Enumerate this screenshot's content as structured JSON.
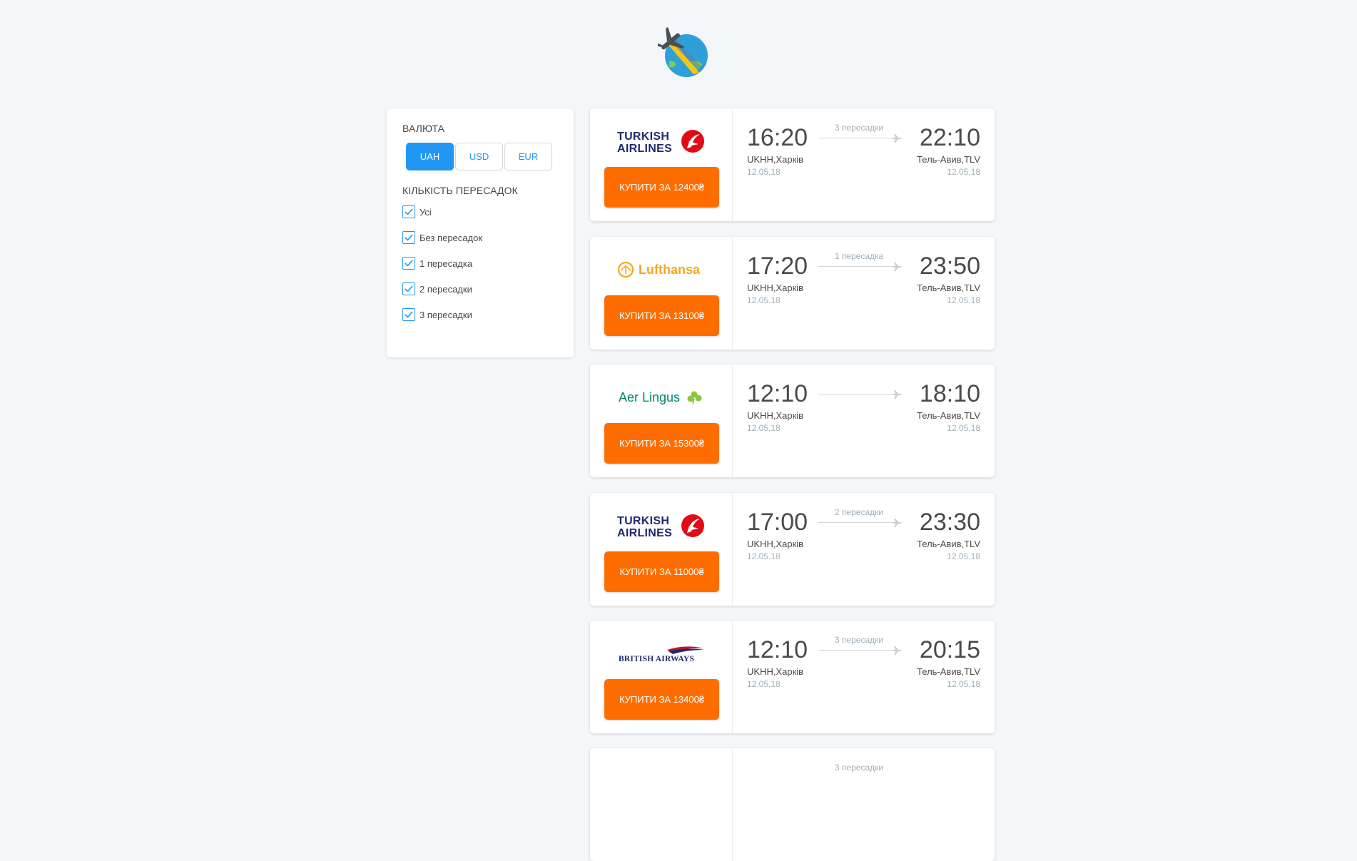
{
  "currency": {
    "title": "Валюта",
    "options": [
      "UAH",
      "USD",
      "EUR"
    ],
    "selected": "UAH"
  },
  "stops_filter": {
    "title": "Кількість пересадок",
    "options": [
      {
        "label": "Усі",
        "checked": true
      },
      {
        "label": "Без пересадок",
        "checked": true
      },
      {
        "label": "1 пересадка",
        "checked": true
      },
      {
        "label": "2 пересадки",
        "checked": true
      },
      {
        "label": "3 пересадки",
        "checked": true
      }
    ]
  },
  "tickets": [
    {
      "airline": "Turkish Airlines",
      "buy_label": "Купити за 12400₴",
      "departure_time": "16:20",
      "arrival_time": "22:10",
      "origin": "UKHH,Харків",
      "destination": "Тель-Авив,TLV",
      "departure_date": "12.05.18",
      "arrival_date": "12.05.18",
      "stops": "3 пересадки"
    },
    {
      "airline": "Lufthansa",
      "buy_label": "Купити за 13100₴",
      "departure_time": "17:20",
      "arrival_time": "23:50",
      "origin": "UKHH,Харків",
      "destination": "Тель-Авив,TLV",
      "departure_date": "12.05.18",
      "arrival_date": "12.05.18",
      "stops": "1 пересадка"
    },
    {
      "airline": "Aer Lingus",
      "buy_label": "Купити за 15300₴",
      "departure_time": "12:10",
      "arrival_time": "18:10",
      "origin": "UKHH,Харків",
      "destination": "Тель-Авив,TLV",
      "departure_date": "12.05.18",
      "arrival_date": "12.05.18",
      "stops": ""
    },
    {
      "airline": "Turkish Airlines",
      "buy_label": "Купити за 11000₴",
      "departure_time": "17:00",
      "arrival_time": "23:30",
      "origin": "UKHH,Харків",
      "destination": "Тель-Авив,TLV",
      "departure_date": "12.05.18",
      "arrival_date": "12.05.18",
      "stops": "2 пересадки"
    },
    {
      "airline": "British Airways",
      "buy_label": "Купити за 13400₴",
      "departure_time": "12:10",
      "arrival_time": "20:15",
      "origin": "UKHH,Харків",
      "destination": "Тель-Авив,TLV",
      "departure_date": "12.05.18",
      "arrival_date": "12.05.18",
      "stops": "3 пересадки"
    },
    {
      "airline": "",
      "buy_label": "",
      "departure_time": "",
      "arrival_time": "",
      "origin": "",
      "destination": "",
      "departure_date": "",
      "arrival_date": "",
      "stops": "3 пересадки"
    }
  ],
  "colors": {
    "accent": "#2196f3",
    "buy_button": "#ff6d00",
    "background": "#f3f7fa"
  }
}
